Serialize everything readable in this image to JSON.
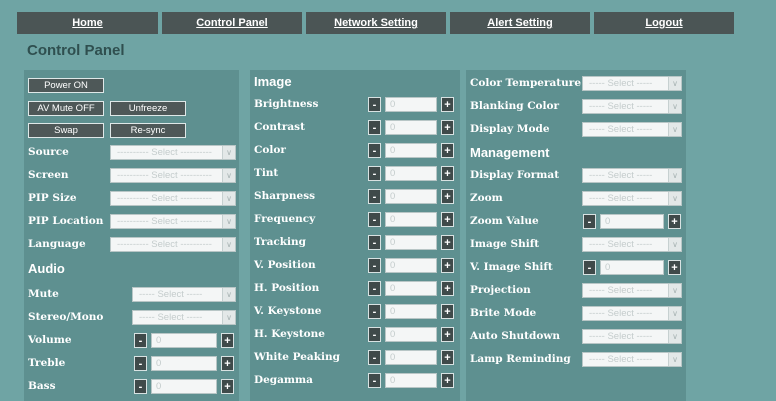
{
  "nav": {
    "items": [
      "Home",
      "Control Panel",
      "Network Setting",
      "Alert Setting",
      "Logout"
    ]
  },
  "page_title": "Control Panel",
  "select_placeholder_long": "---------- Select ----------",
  "select_placeholder_short": "----- Select -----",
  "stepper_value": "0",
  "col1": {
    "buttons": {
      "power": "Power ON",
      "av_mute": "AV Mute OFF",
      "unfreeze": "Unfreeze",
      "swap": "Swap",
      "resync": "Re-sync"
    },
    "selects": [
      "Source",
      "Screen",
      "PIP Size",
      "PIP Location",
      "Language"
    ],
    "audio_title": "Audio",
    "audio_selects": [
      "Mute",
      "Stereo/Mono"
    ],
    "audio_steppers": [
      "Volume",
      "Treble",
      "Bass"
    ]
  },
  "col2": {
    "image_title": "Image",
    "steppers": [
      "Brightness",
      "Contrast",
      "Color",
      "Tint",
      "Sharpness",
      "Frequency",
      "Tracking",
      "V. Position",
      "H. Position",
      "V. Keystone",
      "H. Keystone",
      "White Peaking",
      "Degamma"
    ]
  },
  "col3": {
    "selects_top": [
      "Color Temperature",
      "Blanking Color",
      "Display Mode"
    ],
    "management_title": "Management",
    "mgmt_rows": [
      {
        "label": "Display Format",
        "kind": "select"
      },
      {
        "label": "Zoom",
        "kind": "select"
      },
      {
        "label": "Zoom Value",
        "kind": "stepper"
      },
      {
        "label": "Image Shift",
        "kind": "select"
      },
      {
        "label": "V. Image Shift",
        "kind": "stepper"
      },
      {
        "label": "Projection",
        "kind": "select"
      },
      {
        "label": "Brite Mode",
        "kind": "select"
      },
      {
        "label": "Auto Shutdown",
        "kind": "select"
      },
      {
        "label": "Lamp Reminding",
        "kind": "select"
      }
    ]
  }
}
